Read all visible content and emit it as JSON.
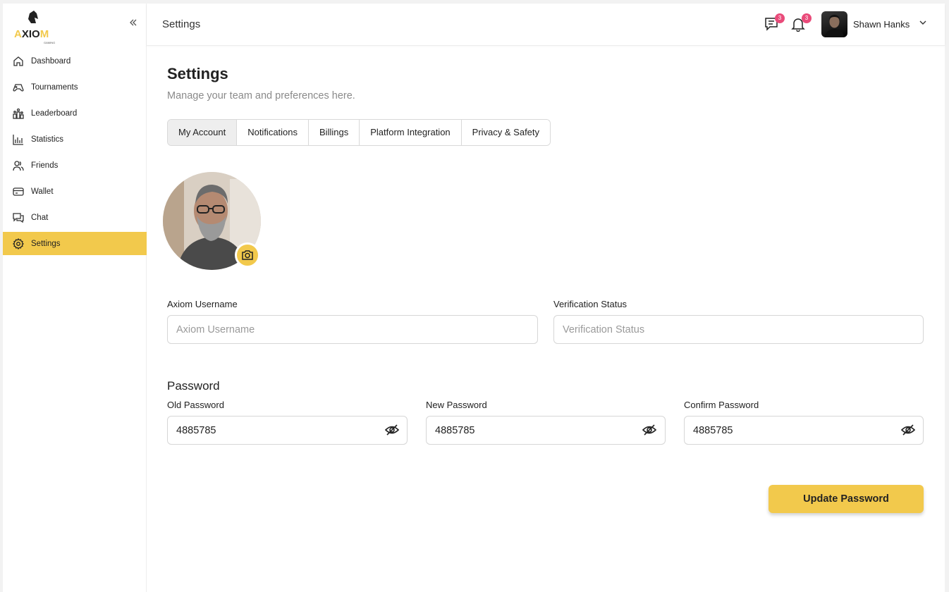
{
  "brand": {
    "logo_text": "AXIOM",
    "logo_sub": "GAMING",
    "accent_color": "#f2c94c"
  },
  "sidebar": {
    "collapse_icon": "chevrons-left-icon",
    "items": [
      {
        "label": "Dashboard",
        "icon": "home-icon",
        "active": false
      },
      {
        "label": "Tournaments",
        "icon": "gamepad-icon",
        "active": false
      },
      {
        "label": "Leaderboard",
        "icon": "leaderboard-icon",
        "active": false
      },
      {
        "label": "Statistics",
        "icon": "bar-chart-icon",
        "active": false
      },
      {
        "label": "Friends",
        "icon": "users-icon",
        "active": false
      },
      {
        "label": "Wallet",
        "icon": "wallet-icon",
        "active": false
      },
      {
        "label": "Chat",
        "icon": "chat-icon",
        "active": false
      },
      {
        "label": "Settings",
        "icon": "gear-icon",
        "active": true
      }
    ]
  },
  "header": {
    "title": "Settings",
    "messages_badge": "3",
    "notifications_badge": "3",
    "user_name": "Shawn Hanks"
  },
  "main": {
    "title": "Settings",
    "subtitle": "Manage your team and preferences here.",
    "tabs": [
      {
        "label": "My Account",
        "active": true
      },
      {
        "label": "Notifications",
        "active": false
      },
      {
        "label": "Billings",
        "active": false
      },
      {
        "label": "Platform Integration",
        "active": false
      },
      {
        "label": "Privacy & Safety",
        "active": false
      }
    ],
    "form": {
      "username_label": "Axiom Username",
      "username_placeholder": "Axiom Username",
      "verification_label": "Verification Status",
      "verification_placeholder": "Verification Status",
      "password_section": "Password",
      "old_password_label": "Old Password",
      "old_password_value": "4885785",
      "new_password_label": "New Password",
      "new_password_value": "4885785",
      "confirm_password_label": "Confirm Password",
      "confirm_password_value": "4885785",
      "update_button": "Update Password"
    }
  }
}
